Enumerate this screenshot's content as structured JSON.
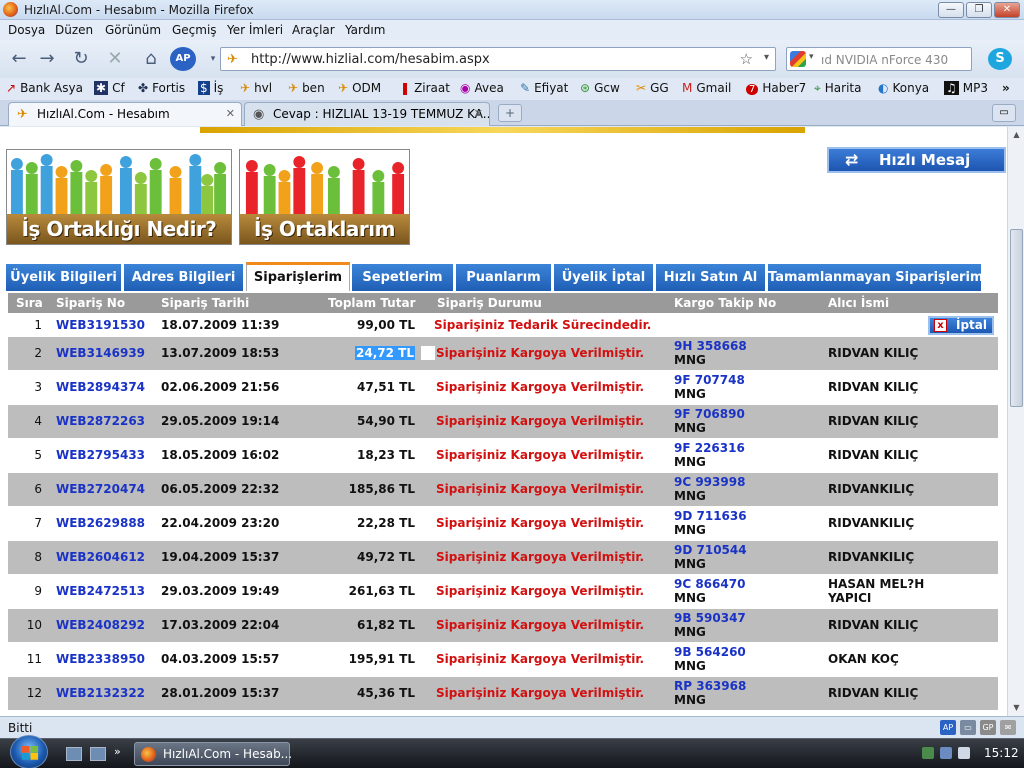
{
  "window": {
    "title": "HızlıAl.Com - Hesabım - Mozilla Firefox",
    "buttons": [
      "—",
      "❐",
      "✕"
    ]
  },
  "menu": [
    "Dosya",
    "Düzen",
    "Görünüm",
    "Geçmiş",
    "Yer İmleri",
    "Araçlar",
    "Yardım"
  ],
  "nav": {
    "url": "http://www.hizlial.com/hesabim.aspx",
    "search": "ıd NVIDIA nForce 430"
  },
  "bookmarks": [
    {
      "icon": "↗",
      "label": "Bank Asya"
    },
    {
      "icon": "✱",
      "label": "Cf"
    },
    {
      "icon": "✤",
      "label": "Fortis"
    },
    {
      "icon": "$",
      "label": "İş"
    },
    {
      "icon": "✈",
      "label": "hvl"
    },
    {
      "icon": "✈",
      "label": "ben"
    },
    {
      "icon": "✈",
      "label": "ODM"
    },
    {
      "icon": "❚",
      "label": "Ziraat"
    },
    {
      "icon": "◉",
      "label": "Avea"
    },
    {
      "icon": "✎",
      "label": "Efiyat"
    },
    {
      "icon": "⊛",
      "label": "Gcw"
    },
    {
      "icon": "✂",
      "label": "GG"
    },
    {
      "icon": "M",
      "label": "Gmail"
    },
    {
      "icon": "7",
      "label": "Haber7"
    },
    {
      "icon": "⌖",
      "label": "Harita"
    },
    {
      "icon": "◐",
      "label": "Konya"
    },
    {
      "icon": "♫",
      "label": "MP3"
    }
  ],
  "tabs": [
    {
      "label": "HızlıAl.Com - Hesabım",
      "active": true
    },
    {
      "label": "Cevap : HIZLIAL 13-19 TEMMUZ KA...",
      "active": false
    }
  ],
  "page": {
    "banners": [
      "İş Ortaklığı Nedir?",
      "İş Ortaklarım"
    ],
    "hizli_mesaj": "Hızlı Mesaj",
    "section_tabs": [
      "Üyelik Bilgileri",
      "Adres Bilgileri",
      "Siparişlerim",
      "Sepetlerim",
      "Puanlarım",
      "Üyelik İptal",
      "Hızlı Satın Al",
      "Tamamlanmayan Siparişlerim"
    ],
    "active_section": "Siparişlerim",
    "columns": [
      "Sıra",
      "Sipariş No",
      "Sipariş Tarihi",
      "Toplam Tutar",
      "Sipariş Durumu",
      "Kargo Takip No",
      "Alıcı İsmi"
    ],
    "cancel_label": "İptal",
    "orders": [
      {
        "sira": "1",
        "no": "WEB3191530",
        "tarih": "18.07.2009 11:39",
        "tutar": "99,00 TL",
        "durum": "Siparişiniz Tedarik Sürecindedir.",
        "kargo": "",
        "firma": "",
        "alici": ""
      },
      {
        "sira": "2",
        "no": "WEB3146939",
        "tarih": "13.07.2009 18:53",
        "tutar": "24,72 TL",
        "durum": "Siparişiniz Kargoya Verilmiştir.",
        "kargo": "9H 358668",
        "firma": "MNG",
        "alici": "RIDVAN KILIÇ"
      },
      {
        "sira": "3",
        "no": "WEB2894374",
        "tarih": "02.06.2009 21:56",
        "tutar": "47,51 TL",
        "durum": "Siparişiniz Kargoya Verilmiştir.",
        "kargo": "9F 707748",
        "firma": "MNG",
        "alici": "RIDVAN KILIÇ"
      },
      {
        "sira": "4",
        "no": "WEB2872263",
        "tarih": "29.05.2009 19:14",
        "tutar": "54,90 TL",
        "durum": "Siparişiniz Kargoya Verilmiştir.",
        "kargo": "9F 706890",
        "firma": "MNG",
        "alici": "RIDVAN KILIÇ"
      },
      {
        "sira": "5",
        "no": "WEB2795433",
        "tarih": "18.05.2009 16:02",
        "tutar": "18,23 TL",
        "durum": "Siparişiniz Kargoya Verilmiştir.",
        "kargo": "9F 226316",
        "firma": "MNG",
        "alici": "RIDVAN KILIÇ"
      },
      {
        "sira": "6",
        "no": "WEB2720474",
        "tarih": "06.05.2009 22:32",
        "tutar": "185,86 TL",
        "durum": "Siparişiniz Kargoya Verilmiştir.",
        "kargo": "9C 993998",
        "firma": "MNG",
        "alici": "RIDVANKILIÇ"
      },
      {
        "sira": "7",
        "no": "WEB2629888",
        "tarih": "22.04.2009 23:20",
        "tutar": "22,28 TL",
        "durum": "Siparişiniz Kargoya Verilmiştir.",
        "kargo": "9D 711636",
        "firma": "MNG",
        "alici": "RIDVANKILIÇ"
      },
      {
        "sira": "8",
        "no": "WEB2604612",
        "tarih": "19.04.2009 15:37",
        "tutar": "49,72 TL",
        "durum": "Siparişiniz Kargoya Verilmiştir.",
        "kargo": "9D 710544",
        "firma": "MNG",
        "alici": "RIDVANKILIÇ"
      },
      {
        "sira": "9",
        "no": "WEB2472513",
        "tarih": "29.03.2009 19:49",
        "tutar": "261,63 TL",
        "durum": "Siparişiniz Kargoya Verilmiştir.",
        "kargo": "9C 866470",
        "firma": "MNG",
        "alici": "HASAN MEL?H YAPICI"
      },
      {
        "sira": "10",
        "no": "WEB2408292",
        "tarih": "17.03.2009 22:04",
        "tutar": "61,82 TL",
        "durum": "Siparişiniz Kargoya Verilmiştir.",
        "kargo": "9B 590347",
        "firma": "MNG",
        "alici": "RIDVAN KILIÇ"
      },
      {
        "sira": "11",
        "no": "WEB2338950",
        "tarih": "04.03.2009 15:57",
        "tutar": "195,91 TL",
        "durum": "Siparişiniz Kargoya Verilmiştir.",
        "kargo": "9B 564260",
        "firma": "MNG",
        "alici": "OKAN KOÇ"
      },
      {
        "sira": "12",
        "no": "WEB2132322",
        "tarih": "28.01.2009 15:37",
        "tutar": "45,36 TL",
        "durum": "Siparişiniz Kargoya Verilmiştir.",
        "kargo": "RP 363968",
        "firma": "MNG",
        "alici": "RIDVAN KILIÇ"
      }
    ]
  },
  "status": "Bitti",
  "taskbar": {
    "item": "HızlıAl.Com - Hesab...",
    "clock": "15:12"
  },
  "colors": {
    "tab_blue": "#1f5fb5",
    "status_red": "#d31010",
    "link_blue": "#1a33c6",
    "row_gray": "#bdbdbd"
  }
}
